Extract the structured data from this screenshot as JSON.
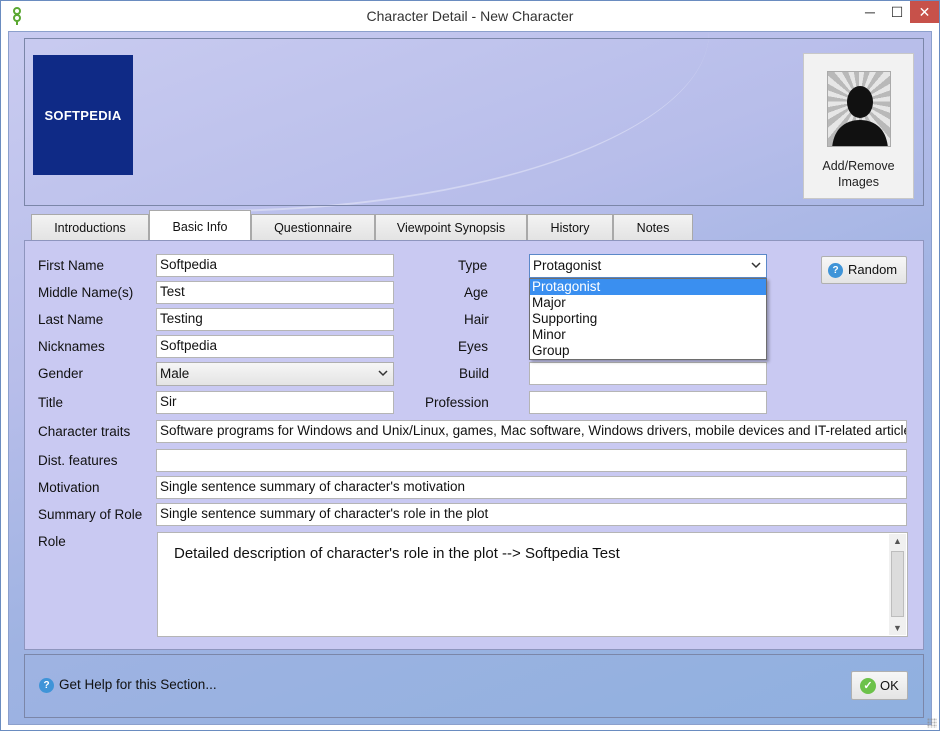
{
  "window": {
    "title": "Character Detail - New Character",
    "minimize": "─",
    "maximize": "☐",
    "close": "✕"
  },
  "header": {
    "logo_text": "SOFTPEDIA",
    "image_button_label": "Add/Remove Images"
  },
  "tabs": [
    {
      "label": "Introductions"
    },
    {
      "label": "Basic Info",
      "active": true
    },
    {
      "label": "Questionnaire"
    },
    {
      "label": "Viewpoint Synopsis"
    },
    {
      "label": "History"
    },
    {
      "label": "Notes"
    }
  ],
  "basic": {
    "first_name_label": "First Name",
    "first_name": "Softpedia",
    "middle_name_label": "Middle Name(s)",
    "middle_name": "Test",
    "last_name_label": "Last Name",
    "last_name": "Testing",
    "nicknames_label": "Nicknames",
    "nicknames": "Softpedia",
    "gender_label": "Gender",
    "gender": "Male",
    "title_label": "Title",
    "title": "Sir",
    "traits_label": "Character traits",
    "traits": "Software programs for Windows and Unix/Linux, games, Mac software, Windows drivers, mobile devices and IT-related articles",
    "dist_label": "Dist. features",
    "dist": "",
    "motivation_label": "Motivation",
    "motivation": "Single sentence summary of character's motivation",
    "summary_label": "Summary of Role",
    "summary": "Single sentence summary of character's role in the plot",
    "role_label": "Role",
    "role": "Detailed description of character's role in the plot --> Softpedia Test"
  },
  "right": {
    "type_label": "Type",
    "type": "Protagonist",
    "type_options": [
      "Protagonist",
      "Major",
      "Supporting",
      "Minor",
      "Group"
    ],
    "age_label": "Age",
    "hair_label": "Hair",
    "eyes_label": "Eyes",
    "build_label": "Build",
    "build": "",
    "profession_label": "Profession",
    "profession": "",
    "random_label": "Random"
  },
  "footer": {
    "help_label": "Get Help for this Section...",
    "ok_label": "OK"
  },
  "colors": {
    "logo_bg": "#0f2a86",
    "dropdown_selected": "#3a8ff0",
    "close_button": "#c7514a"
  }
}
